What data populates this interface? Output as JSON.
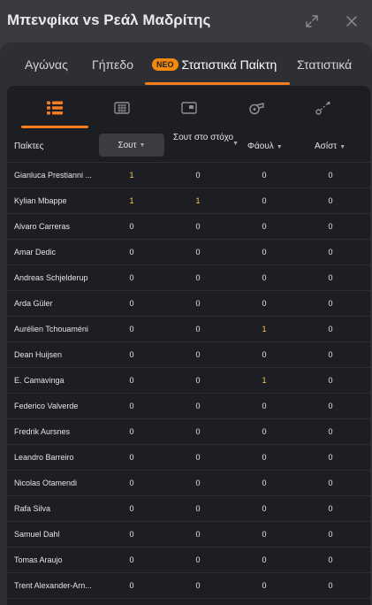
{
  "window": {
    "title": "Μπενφίκα vs Ρεάλ Μαδρίτης",
    "expand_icon": "expand-arrows-icon",
    "close_icon": "close-icon"
  },
  "tabs": [
    {
      "label": "Αγώνας",
      "active": false
    },
    {
      "label": "Γήπεδο",
      "active": false
    },
    {
      "label": "Στατιστικά Παίκτη",
      "badge": "ΝΕΟ",
      "active": true
    },
    {
      "label": "Στατιστικά",
      "active": false
    }
  ],
  "categories": [
    {
      "icon": "list-icon",
      "active": true
    },
    {
      "icon": "goal-net-icon",
      "active": false
    },
    {
      "icon": "goalkeeper-goal-icon",
      "active": false
    },
    {
      "icon": "whistle-icon",
      "active": false
    },
    {
      "icon": "pass-icon",
      "active": false
    }
  ],
  "table": {
    "headers": {
      "players": "Παίκτες",
      "shots": "Σουτ",
      "on_target": "Σουτ στο στόχο",
      "fouls": "Φάουλ",
      "assists": "Ασίστ"
    },
    "sorted_column": "shots",
    "rows": [
      {
        "name": "Gianluca Prestianni ...",
        "shots": "1",
        "on_target": "0",
        "fouls": "0",
        "assists": "0"
      },
      {
        "name": "Kylian Mbappe",
        "shots": "1",
        "on_target": "1",
        "fouls": "0",
        "assists": "0"
      },
      {
        "name": "Alvaro Carreras",
        "shots": "0",
        "on_target": "0",
        "fouls": "0",
        "assists": "0"
      },
      {
        "name": "Amar Dedic",
        "shots": "0",
        "on_target": "0",
        "fouls": "0",
        "assists": "0"
      },
      {
        "name": "Andreas Schjelderup",
        "shots": "0",
        "on_target": "0",
        "fouls": "0",
        "assists": "0"
      },
      {
        "name": "Arda Güler",
        "shots": "0",
        "on_target": "0",
        "fouls": "0",
        "assists": "0"
      },
      {
        "name": "Aurélien Tchouaméni",
        "shots": "0",
        "on_target": "0",
        "fouls": "1",
        "assists": "0"
      },
      {
        "name": "Dean Huijsen",
        "shots": "0",
        "on_target": "0",
        "fouls": "0",
        "assists": "0"
      },
      {
        "name": "E. Camavinga",
        "shots": "0",
        "on_target": "0",
        "fouls": "1",
        "assists": "0"
      },
      {
        "name": "Federico Valverde",
        "shots": "0",
        "on_target": "0",
        "fouls": "0",
        "assists": "0"
      },
      {
        "name": "Fredrik Aursnes",
        "shots": "0",
        "on_target": "0",
        "fouls": "0",
        "assists": "0"
      },
      {
        "name": "Leandro Barreiro",
        "shots": "0",
        "on_target": "0",
        "fouls": "0",
        "assists": "0"
      },
      {
        "name": "Nicolas Otamendi",
        "shots": "0",
        "on_target": "0",
        "fouls": "0",
        "assists": "0"
      },
      {
        "name": "Rafa Silva",
        "shots": "0",
        "on_target": "0",
        "fouls": "0",
        "assists": "0"
      },
      {
        "name": "Samuel Dahl",
        "shots": "0",
        "on_target": "0",
        "fouls": "0",
        "assists": "0"
      },
      {
        "name": "Tomas Araujo",
        "shots": "0",
        "on_target": "0",
        "fouls": "0",
        "assists": "0"
      },
      {
        "name": "Trent Alexander-Arn...",
        "shots": "0",
        "on_target": "0",
        "fouls": "0",
        "assists": "0"
      }
    ]
  },
  "colors": {
    "accent": "#f57c1f",
    "highlight_value": "#f7c948",
    "badge": "#f0890c"
  }
}
